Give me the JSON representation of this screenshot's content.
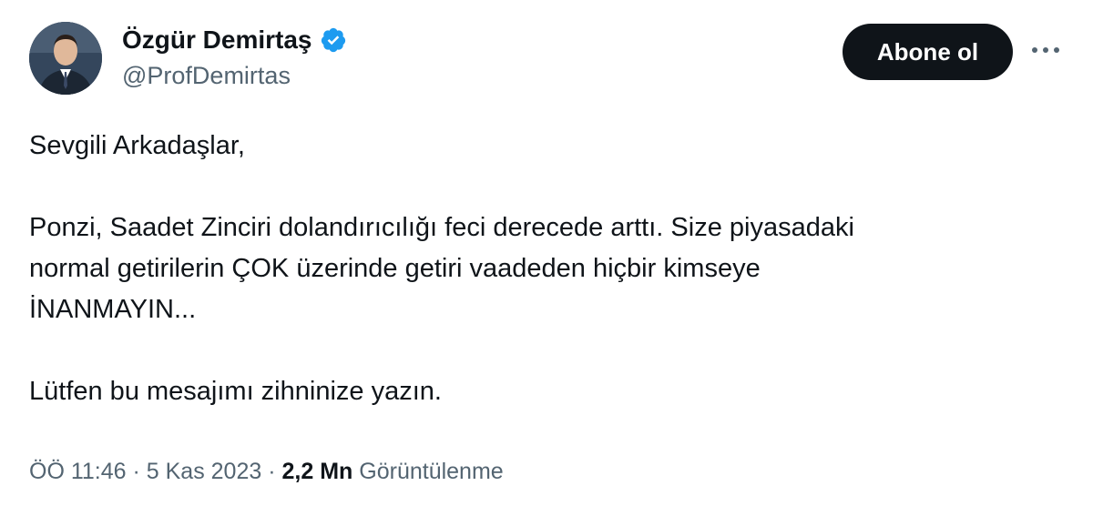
{
  "author": {
    "display_name": "Özgür Demirtaş",
    "handle": "@ProfDemirtas",
    "verified_icon": "verified-badge-icon",
    "verified_color": "#1d9bf0"
  },
  "actions": {
    "follow_label": "Abone ol",
    "more_icon": "more-horizontal-icon"
  },
  "tweet": {
    "lines": [
      "Sevgili Arkadaşlar,",
      "",
      "Ponzi, Saadet Zinciri dolandırıcılığı feci derecede arttı. Size piyasadaki",
      "normal getirilerin ÇOK üzerinde getiri vaadeden hiçbir kimseye",
      "İNANMAYIN...",
      "",
      "Lütfen bu mesajımı zihninize yazın."
    ]
  },
  "meta": {
    "time": "ÖÖ 11:46",
    "date": "5 Kas 2023",
    "views_count": "2,2 Mn",
    "views_label": "Görüntülenme",
    "separator": "·"
  },
  "colors": {
    "text": "#0f1419",
    "secondary": "#536471",
    "button_bg": "#0f1419",
    "button_text": "#ffffff"
  }
}
